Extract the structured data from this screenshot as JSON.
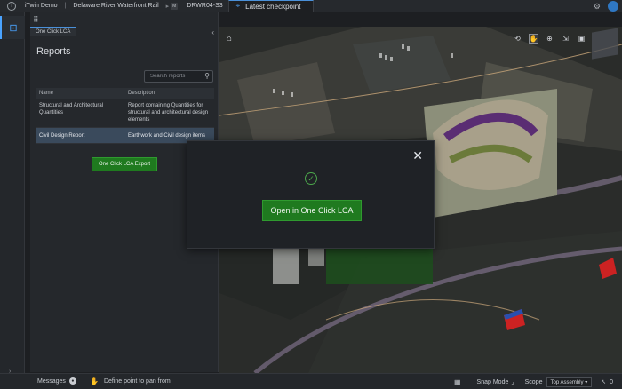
{
  "breadcrumbs": {
    "product": "iTwin Demo",
    "project": "Delaware River Waterfront Rail",
    "model_chip": "M",
    "model": "DRWR04-S3",
    "checkpoint": "Latest checkpoint"
  },
  "panel": {
    "tab": "One Click LCA",
    "title": "Reports",
    "search_placeholder": "Search reports",
    "columns": [
      "Name",
      "Description"
    ],
    "rows": [
      {
        "name": "Structural and Architectural Quantities",
        "description": "Report containing Quantities for structural and architectural design elements"
      },
      {
        "name": "Civil Design Report",
        "description": "Earthwork and Civil design items"
      }
    ],
    "export_label": "One Click LCA Export"
  },
  "modal": {
    "open_label": "Open in One Click LCA"
  },
  "status": {
    "messages_label": "Messages",
    "hint": "Define point to pan from",
    "snap_mode": "Snap Mode",
    "scope_label": "Scope",
    "scope_value": "Top Assembly",
    "count": "0"
  },
  "colors": {
    "accent": "#4aa3ff",
    "primary_button": "#1f7a1f",
    "selected_row": "#3a4a5c"
  }
}
